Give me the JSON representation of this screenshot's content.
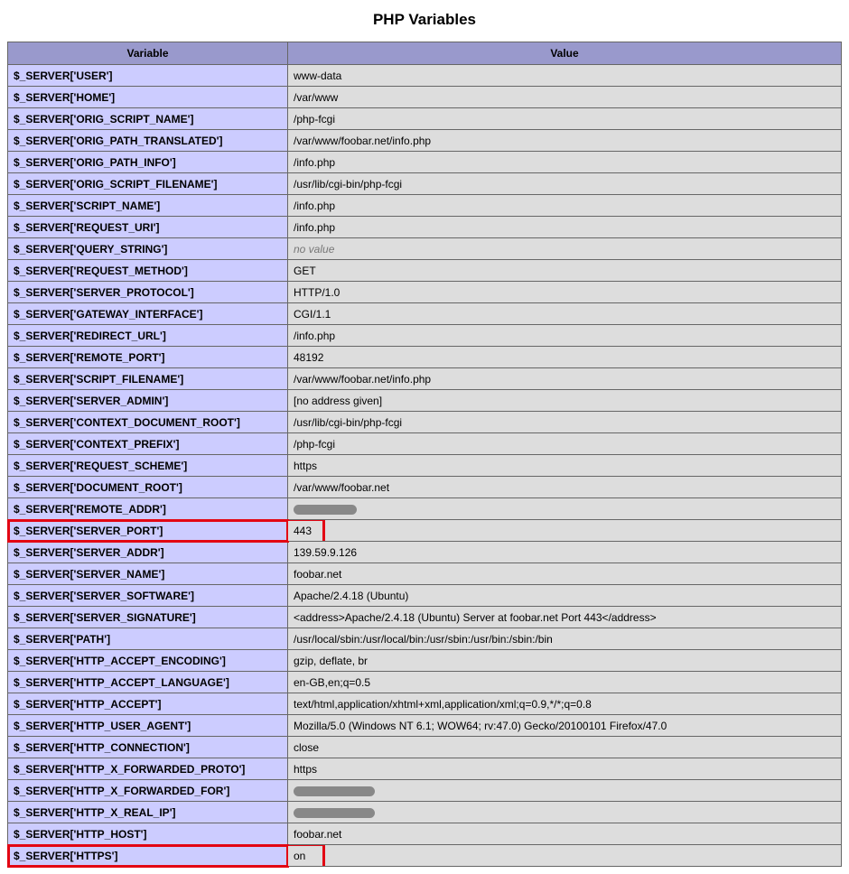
{
  "title": "PHP Variables",
  "headers": {
    "variable": "Variable",
    "value": "Value"
  },
  "rows": [
    {
      "var": "$_SERVER['USER']",
      "val": "www-data"
    },
    {
      "var": "$_SERVER['HOME']",
      "val": "/var/www"
    },
    {
      "var": "$_SERVER['ORIG_SCRIPT_NAME']",
      "val": "/php-fcgi"
    },
    {
      "var": "$_SERVER['ORIG_PATH_TRANSLATED']",
      "val": "/var/www/foobar.net/info.php"
    },
    {
      "var": "$_SERVER['ORIG_PATH_INFO']",
      "val": "/info.php"
    },
    {
      "var": "$_SERVER['ORIG_SCRIPT_FILENAME']",
      "val": "/usr/lib/cgi-bin/php-fcgi"
    },
    {
      "var": "$_SERVER['SCRIPT_NAME']",
      "val": "/info.php"
    },
    {
      "var": "$_SERVER['REQUEST_URI']",
      "val": "/info.php"
    },
    {
      "var": "$_SERVER['QUERY_STRING']",
      "val": "no value",
      "novalue": true
    },
    {
      "var": "$_SERVER['REQUEST_METHOD']",
      "val": "GET"
    },
    {
      "var": "$_SERVER['SERVER_PROTOCOL']",
      "val": "HTTP/1.0"
    },
    {
      "var": "$_SERVER['GATEWAY_INTERFACE']",
      "val": "CGI/1.1"
    },
    {
      "var": "$_SERVER['REDIRECT_URL']",
      "val": "/info.php"
    },
    {
      "var": "$_SERVER['REMOTE_PORT']",
      "val": "48192"
    },
    {
      "var": "$_SERVER['SCRIPT_FILENAME']",
      "val": "/var/www/foobar.net/info.php"
    },
    {
      "var": "$_SERVER['SERVER_ADMIN']",
      "val": "[no address given]"
    },
    {
      "var": "$_SERVER['CONTEXT_DOCUMENT_ROOT']",
      "val": "/usr/lib/cgi-bin/php-fcgi"
    },
    {
      "var": "$_SERVER['CONTEXT_PREFIX']",
      "val": "/php-fcgi"
    },
    {
      "var": "$_SERVER['REQUEST_SCHEME']",
      "val": "https"
    },
    {
      "var": "$_SERVER['DOCUMENT_ROOT']",
      "val": "/var/www/foobar.net"
    },
    {
      "var": "$_SERVER['REMOTE_ADDR']",
      "val": "",
      "redacted": "short"
    },
    {
      "var": "$_SERVER['SERVER_PORT']",
      "val": "443",
      "highlight": true,
      "highlightVal": true
    },
    {
      "var": "$_SERVER['SERVER_ADDR']",
      "val": "139.59.9.126"
    },
    {
      "var": "$_SERVER['SERVER_NAME']",
      "val": "foobar.net"
    },
    {
      "var": "$_SERVER['SERVER_SOFTWARE']",
      "val": "Apache/2.4.18 (Ubuntu)"
    },
    {
      "var": "$_SERVER['SERVER_SIGNATURE']",
      "val": "<address>Apache/2.4.18 (Ubuntu) Server at foobar.net Port 443</address>"
    },
    {
      "var": "$_SERVER['PATH']",
      "val": "/usr/local/sbin:/usr/local/bin:/usr/sbin:/usr/bin:/sbin:/bin"
    },
    {
      "var": "$_SERVER['HTTP_ACCEPT_ENCODING']",
      "val": "gzip, deflate, br"
    },
    {
      "var": "$_SERVER['HTTP_ACCEPT_LANGUAGE']",
      "val": "en-GB,en;q=0.5"
    },
    {
      "var": "$_SERVER['HTTP_ACCEPT']",
      "val": "text/html,application/xhtml+xml,application/xml;q=0.9,*/*;q=0.8"
    },
    {
      "var": "$_SERVER['HTTP_USER_AGENT']",
      "val": "Mozilla/5.0 (Windows NT 6.1; WOW64; rv:47.0) Gecko/20100101 Firefox/47.0"
    },
    {
      "var": "$_SERVER['HTTP_CONNECTION']",
      "val": "close"
    },
    {
      "var": "$_SERVER['HTTP_X_FORWARDED_PROTO']",
      "val": "https"
    },
    {
      "var": "$_SERVER['HTTP_X_FORWARDED_FOR']",
      "val": "",
      "redacted": "med"
    },
    {
      "var": "$_SERVER['HTTP_X_REAL_IP']",
      "val": "",
      "redacted": "med"
    },
    {
      "var": "$_SERVER['HTTP_HOST']",
      "val": "foobar.net"
    },
    {
      "var": "$_SERVER['HTTPS']",
      "val": "on",
      "highlight": true,
      "highlightVal": true
    }
  ]
}
